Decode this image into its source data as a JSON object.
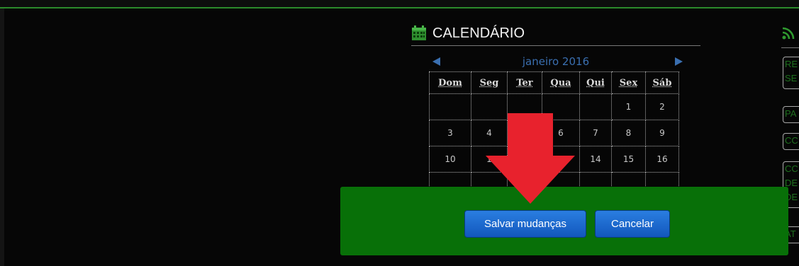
{
  "calendar": {
    "title": "CALENDÁRIO",
    "month": "janeiro 2016",
    "weekdays": [
      "Dom",
      "Seg",
      "Ter",
      "Qua",
      "Qui",
      "Sex",
      "Sáb"
    ],
    "weeks": [
      [
        "",
        "",
        "",
        "",
        "",
        "1",
        "2"
      ],
      [
        "3",
        "4",
        "",
        "6",
        "7",
        "8",
        "9"
      ],
      [
        "10",
        "1",
        "",
        "",
        "14",
        "15",
        "16"
      ],
      [
        "",
        "",
        "",
        "",
        "",
        "",
        ""
      ],
      [
        "",
        "",
        "",
        "",
        "",
        "",
        ""
      ],
      [
        "",
        "",
        "",
        "",
        "",
        "",
        ""
      ]
    ]
  },
  "sidebar_right": {
    "items": [
      "RE\nSE",
      "PA",
      "CC",
      "CC\nDE\nDE",
      "AT"
    ]
  },
  "modal": {
    "save_label": "Salvar mudanças",
    "cancel_label": "Cancelar"
  },
  "colors": {
    "accent_green": "#087008",
    "button_blue": "#1a6ad4",
    "arrow_red": "#e8222d",
    "link_blue": "#3a6fb0"
  },
  "icons": [
    "calendar-icon",
    "rss-icon",
    "prev-month-icon",
    "next-month-icon",
    "down-arrow-icon"
  ]
}
